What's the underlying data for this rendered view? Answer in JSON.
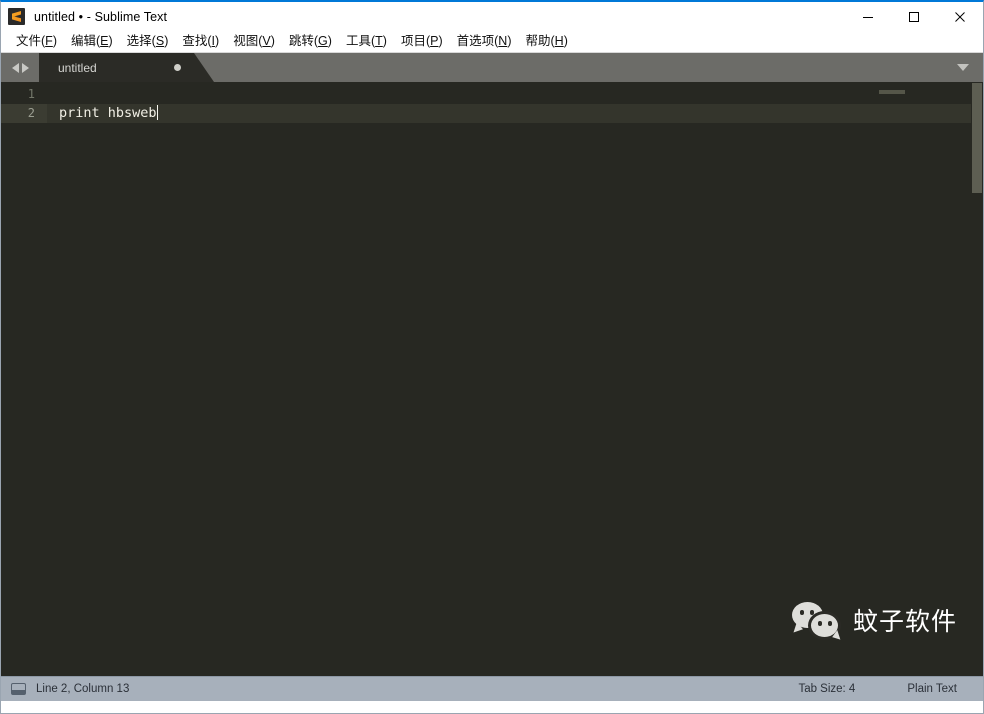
{
  "window": {
    "title": "untitled • - Sublime Text",
    "accent_color": "#0078d7",
    "icon": "sublime-text-icon",
    "controls": {
      "minimize": "minimize-icon",
      "maximize": "maximize-icon",
      "close": "close-icon"
    }
  },
  "menubar": {
    "items": [
      {
        "label": "文件(F)",
        "text": "文件(",
        "accel": "F",
        "tail": ")"
      },
      {
        "label": "编辑(E)",
        "text": "编辑(",
        "accel": "E",
        "tail": ")"
      },
      {
        "label": "选择(S)",
        "text": "选择(",
        "accel": "S",
        "tail": ")"
      },
      {
        "label": "查找(I)",
        "text": "查找(",
        "accel": "I",
        "tail": ")"
      },
      {
        "label": "视图(V)",
        "text": "视图(",
        "accel": "V",
        "tail": ")"
      },
      {
        "label": "跳转(G)",
        "text": "跳转(",
        "accel": "G",
        "tail": ")"
      },
      {
        "label": "工具(T)",
        "text": "工具(",
        "accel": "T",
        "tail": ")"
      },
      {
        "label": "项目(P)",
        "text": "项目(",
        "accel": "P",
        "tail": ")"
      },
      {
        "label": "首选项(N)",
        "text": "首选项(",
        "accel": "N",
        "tail": ")"
      },
      {
        "label": "帮助(H)",
        "text": "帮助(",
        "accel": "H",
        "tail": ")"
      }
    ]
  },
  "tabbar": {
    "nav_back": "arrow-left-icon",
    "nav_forward": "arrow-right-icon",
    "menu": "chevron-down-icon",
    "tabs": [
      {
        "label": "untitled",
        "dirty": true,
        "active": true
      }
    ]
  },
  "editor": {
    "background": "#272822",
    "lines": [
      {
        "number": "1",
        "text": "",
        "active": false
      },
      {
        "number": "2",
        "text": "print hbsweb",
        "active": true
      }
    ],
    "cursor_line": 2,
    "cursor_column": 13
  },
  "watermark": {
    "logo": "wechat-icon",
    "text": "蚊子软件"
  },
  "statusbar": {
    "console_icon": "console-icon",
    "position": "Line 2, Column 13",
    "tab_size": "Tab Size: 4",
    "syntax": "Plain Text"
  }
}
